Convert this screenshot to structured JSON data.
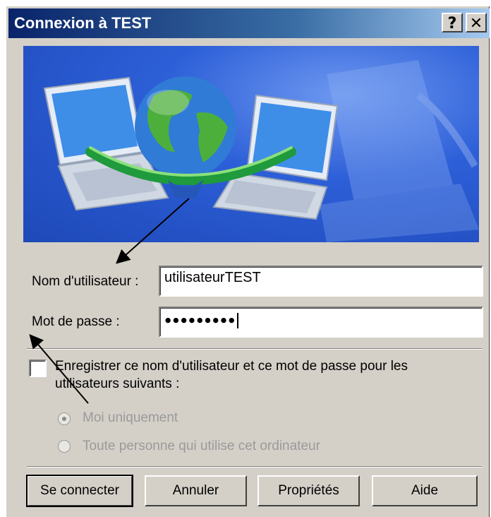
{
  "window": {
    "title": "Connexion à TEST",
    "help_glyph": "?",
    "close_glyph": "✕"
  },
  "form": {
    "username_label": "Nom d'utilisateur :",
    "username_value": "utilisateurTEST",
    "password_label": "Mot de passe :",
    "password_masked": "●●●●●●●●●"
  },
  "save_option": {
    "label": "Enregistrer ce nom d'utilisateur et ce mot de passe pour les utilisateurs suivants :",
    "checked": false,
    "radios": [
      {
        "label": "Moi uniquement",
        "selected": true,
        "enabled": false
      },
      {
        "label": "Toute personne qui utilise cet ordinateur",
        "selected": false,
        "enabled": false
      }
    ]
  },
  "buttons": {
    "connect": "Se connecter",
    "cancel": "Annuler",
    "properties": "Propriétés",
    "help": "Aide"
  },
  "colors": {
    "titlebar_start": "#0a246a",
    "titlebar_end": "#a6caf0",
    "dialog_face": "#d4d0c8",
    "banner_blue": "#2d5fd8"
  },
  "icons": [
    "help-icon",
    "close-icon",
    "globe-icon",
    "laptop-icon",
    "annotation-arrow"
  ]
}
